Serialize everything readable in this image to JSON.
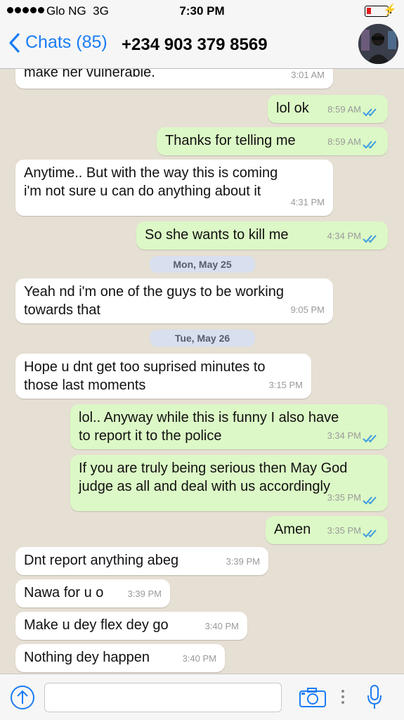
{
  "status_bar": {
    "carrier": "Glo NG",
    "network": "3G",
    "time": "7:30 PM"
  },
  "header": {
    "back_label": "Chats (85)",
    "contact": "+234 903 379 8569"
  },
  "messages": [
    {
      "dir": "in",
      "lines": [
        "make her vulnerable."
      ],
      "time": "3:01 AM"
    },
    {
      "dir": "out",
      "lines": [
        "lol ok"
      ],
      "time": "8:59 AM"
    },
    {
      "dir": "out",
      "lines": [
        "Thanks for telling me"
      ],
      "time": "8:59 AM"
    },
    {
      "dir": "in",
      "lines": [
        "Anytime.. But with the way this is coming",
        "i'm not sure u can do anything about it"
      ],
      "time": "4:31 PM"
    },
    {
      "dir": "out",
      "lines": [
        "So she wants to kill me"
      ],
      "time": "4:34 PM"
    },
    {
      "date": "Mon, May 25"
    },
    {
      "dir": "in",
      "lines": [
        "Yeah nd i'm one of the guys to be working",
        "towards that"
      ],
      "time": "9:05 PM"
    },
    {
      "date": "Tue, May 26"
    },
    {
      "dir": "in",
      "lines": [
        "Hope u dnt get too suprised minutes to",
        "those last moments"
      ],
      "time": "3:15 PM"
    },
    {
      "dir": "out",
      "lines": [
        "lol.. Anyway while this is funny I also have",
        "to report it to the police"
      ],
      "time": "3:34 PM"
    },
    {
      "dir": "out",
      "lines": [
        "If you are truly being serious then May God",
        "judge as all and deal with us accordingly"
      ],
      "time": "3:35 PM"
    },
    {
      "dir": "out",
      "lines": [
        "Amen"
      ],
      "time": "3:35 PM"
    },
    {
      "dir": "in",
      "lines": [
        "Dnt report anything abeg"
      ],
      "time": "3:39 PM"
    },
    {
      "dir": "in",
      "lines": [
        "Nawa for u o"
      ],
      "time": "3:39 PM"
    },
    {
      "dir": "in",
      "lines": [
        "Make u dey flex dey go"
      ],
      "time": "3:40 PM"
    },
    {
      "dir": "in",
      "lines": [
        "Nothing dey happen"
      ],
      "time": "3:40 PM"
    }
  ],
  "input": {
    "value": "",
    "placeholder": ""
  },
  "colors": {
    "accent": "#1a7cf5",
    "outgoing_bubble": "#dcf8c6",
    "incoming_bubble": "#ffffff",
    "read_ticks": "#3a9be0",
    "battery_low": "#e21d1d"
  },
  "icons": {
    "upload": "upload-arrow-icon",
    "camera": "camera-icon",
    "mic": "microphone-icon",
    "back": "chevron-left-icon",
    "read": "double-check-icon"
  }
}
